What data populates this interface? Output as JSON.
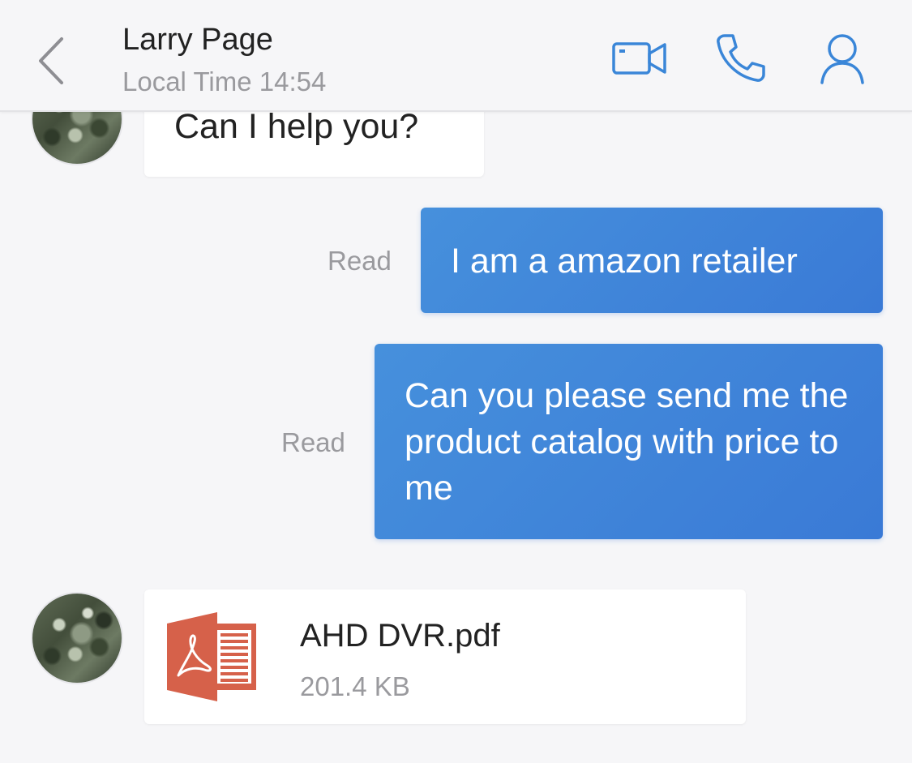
{
  "header": {
    "contact_name": "Larry Page",
    "local_time": "Local Time 14:54",
    "icons": {
      "back": "chevron-left-icon",
      "video": "video-camera-icon",
      "call": "phone-icon",
      "profile": "user-icon"
    }
  },
  "colors": {
    "accent": "#3a86d8",
    "bubble_out": "#3d80d8",
    "bubble_in": "#ffffff",
    "background": "#f6f6f8",
    "pdf_red": "#d6614a"
  },
  "messages": [
    {
      "direction": "incoming",
      "text": "Can I help you?"
    },
    {
      "direction": "outgoing",
      "text": "I am a amazon retailer",
      "status": "Read"
    },
    {
      "direction": "outgoing",
      "text": "Can you please send me the product catalog with price to me",
      "status": "Read"
    },
    {
      "direction": "incoming",
      "type": "file",
      "file": {
        "name": "AHD DVR.pdf",
        "size": "201.4 KB",
        "icon": "pdf-file-icon"
      }
    }
  ]
}
